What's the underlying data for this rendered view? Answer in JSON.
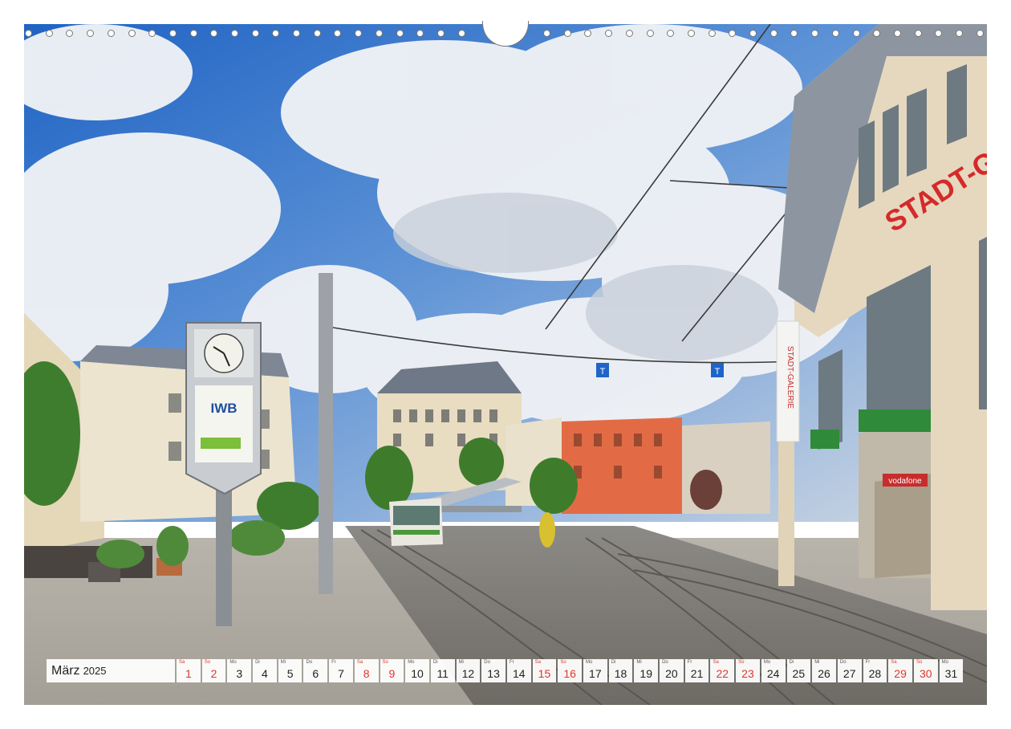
{
  "photo": {
    "signs": {
      "store_sign": "STADT-G",
      "clock_ad": "IWB",
      "banner": "STADT-GALERIE",
      "stop_marker": "T",
      "shop_sign": "vodafone"
    }
  },
  "calendar": {
    "month": "März",
    "year": "2025",
    "days": [
      {
        "wd": "Sa",
        "day": "1",
        "weekend": true
      },
      {
        "wd": "So",
        "day": "2",
        "weekend": true
      },
      {
        "wd": "Mo",
        "day": "3",
        "weekend": false
      },
      {
        "wd": "Di",
        "day": "4",
        "weekend": false
      },
      {
        "wd": "Mi",
        "day": "5",
        "weekend": false
      },
      {
        "wd": "Do",
        "day": "6",
        "weekend": false
      },
      {
        "wd": "Fr",
        "day": "7",
        "weekend": false
      },
      {
        "wd": "Sa",
        "day": "8",
        "weekend": true
      },
      {
        "wd": "So",
        "day": "9",
        "weekend": true
      },
      {
        "wd": "Mo",
        "day": "10",
        "weekend": false
      },
      {
        "wd": "Di",
        "day": "11",
        "weekend": false
      },
      {
        "wd": "Mi",
        "day": "12",
        "weekend": false
      },
      {
        "wd": "Do",
        "day": "13",
        "weekend": false
      },
      {
        "wd": "Fr",
        "day": "14",
        "weekend": false
      },
      {
        "wd": "Sa",
        "day": "15",
        "weekend": true
      },
      {
        "wd": "So",
        "day": "16",
        "weekend": true
      },
      {
        "wd": "Mo",
        "day": "17",
        "weekend": false
      },
      {
        "wd": "Di",
        "day": "18",
        "weekend": false
      },
      {
        "wd": "Mi",
        "day": "19",
        "weekend": false
      },
      {
        "wd": "Do",
        "day": "20",
        "weekend": false
      },
      {
        "wd": "Fr",
        "day": "21",
        "weekend": false
      },
      {
        "wd": "Sa",
        "day": "22",
        "weekend": true
      },
      {
        "wd": "So",
        "day": "23",
        "weekend": true
      },
      {
        "wd": "Mo",
        "day": "24",
        "weekend": false
      },
      {
        "wd": "Di",
        "day": "25",
        "weekend": false
      },
      {
        "wd": "Mi",
        "day": "26",
        "weekend": false
      },
      {
        "wd": "Do",
        "day": "27",
        "weekend": false
      },
      {
        "wd": "Fr",
        "day": "28",
        "weekend": false
      },
      {
        "wd": "Sa",
        "day": "29",
        "weekend": true
      },
      {
        "wd": "So",
        "day": "30",
        "weekend": true
      },
      {
        "wd": "Mo",
        "day": "31",
        "weekend": false
      }
    ]
  }
}
